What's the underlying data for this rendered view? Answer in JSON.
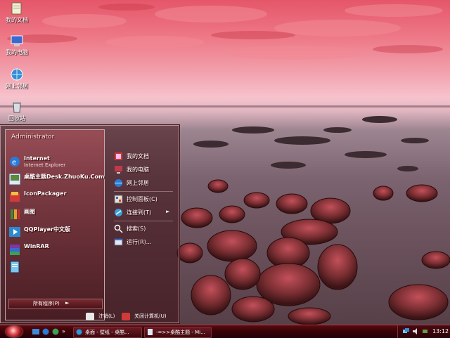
{
  "desktop_icons": [
    {
      "label": "我的文档",
      "icon": "my-documents-icon"
    },
    {
      "label": "我的电脑",
      "icon": "my-computer-icon"
    },
    {
      "label": "网上邻居",
      "icon": "network-places-icon"
    },
    {
      "label": "回收站",
      "icon": "recycle-bin-icon"
    }
  ],
  "start_menu": {
    "user": "Administrator",
    "programs": [
      {
        "title": "Internet",
        "subtitle": "Internet Explorer",
        "icon": "internet-explorer-icon"
      },
      {
        "title": "桌酷主题Desk.ZhuoKu.Com",
        "subtitle": "",
        "icon": "zhuoku-theme-icon"
      },
      {
        "title": "IconPackager",
        "subtitle": "",
        "icon": "iconpackager-icon"
      },
      {
        "title": "画图",
        "subtitle": "",
        "icon": "paint-icon"
      },
      {
        "title": "QQPlayer中文版",
        "subtitle": "",
        "icon": "qqplayer-icon"
      },
      {
        "title": "WinRAR",
        "subtitle": "",
        "icon": "winrar-icon"
      },
      {
        "title": "",
        "subtitle": "",
        "icon": "notepad-icon"
      }
    ],
    "all_programs": "所有程序(P)",
    "right_items": [
      {
        "label": "我的文档",
        "icon": "my-documents-icon"
      },
      {
        "label": "我的电脑",
        "icon": "my-computer-icon"
      },
      {
        "label": "网上邻居",
        "icon": "network-places-icon"
      },
      {
        "label": "控制面板(C)",
        "icon": "control-panel-icon"
      },
      {
        "label": "连接到(T)",
        "icon": "connect-to-icon"
      },
      {
        "label": "搜索(S)",
        "icon": "search-icon"
      },
      {
        "label": "运行(R)...",
        "icon": "run-icon"
      }
    ],
    "logoff": "注销(L)",
    "shutdown": "关闭计算机(U)"
  },
  "taskbar": {
    "tasks": [
      {
        "label": "桌面 - 壁纸 - 桌酷...",
        "icon": "browser-icon"
      },
      {
        "label": "-=>>桌酷主题 - Mi...",
        "icon": "document-icon"
      }
    ],
    "clock": "13:12"
  },
  "colors": {
    "accent": "#e04a50",
    "taskbar": "#3a0406"
  }
}
